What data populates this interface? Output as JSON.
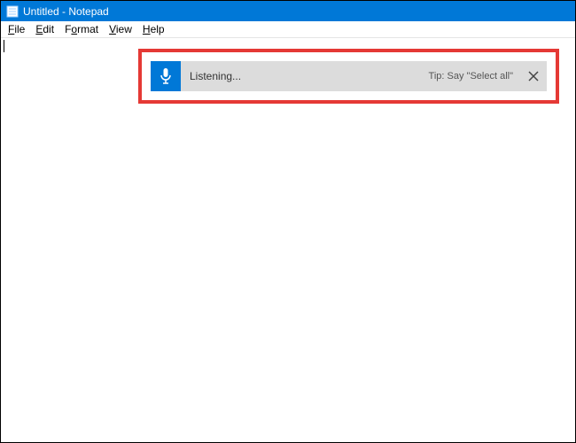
{
  "window": {
    "title": "Untitled - Notepad"
  },
  "menu": {
    "file": "File",
    "edit": "Edit",
    "format": "Format",
    "view": "View",
    "help": "Help"
  },
  "dictation": {
    "status": "Listening...",
    "tip": "Tip: Say \"Select all\""
  }
}
